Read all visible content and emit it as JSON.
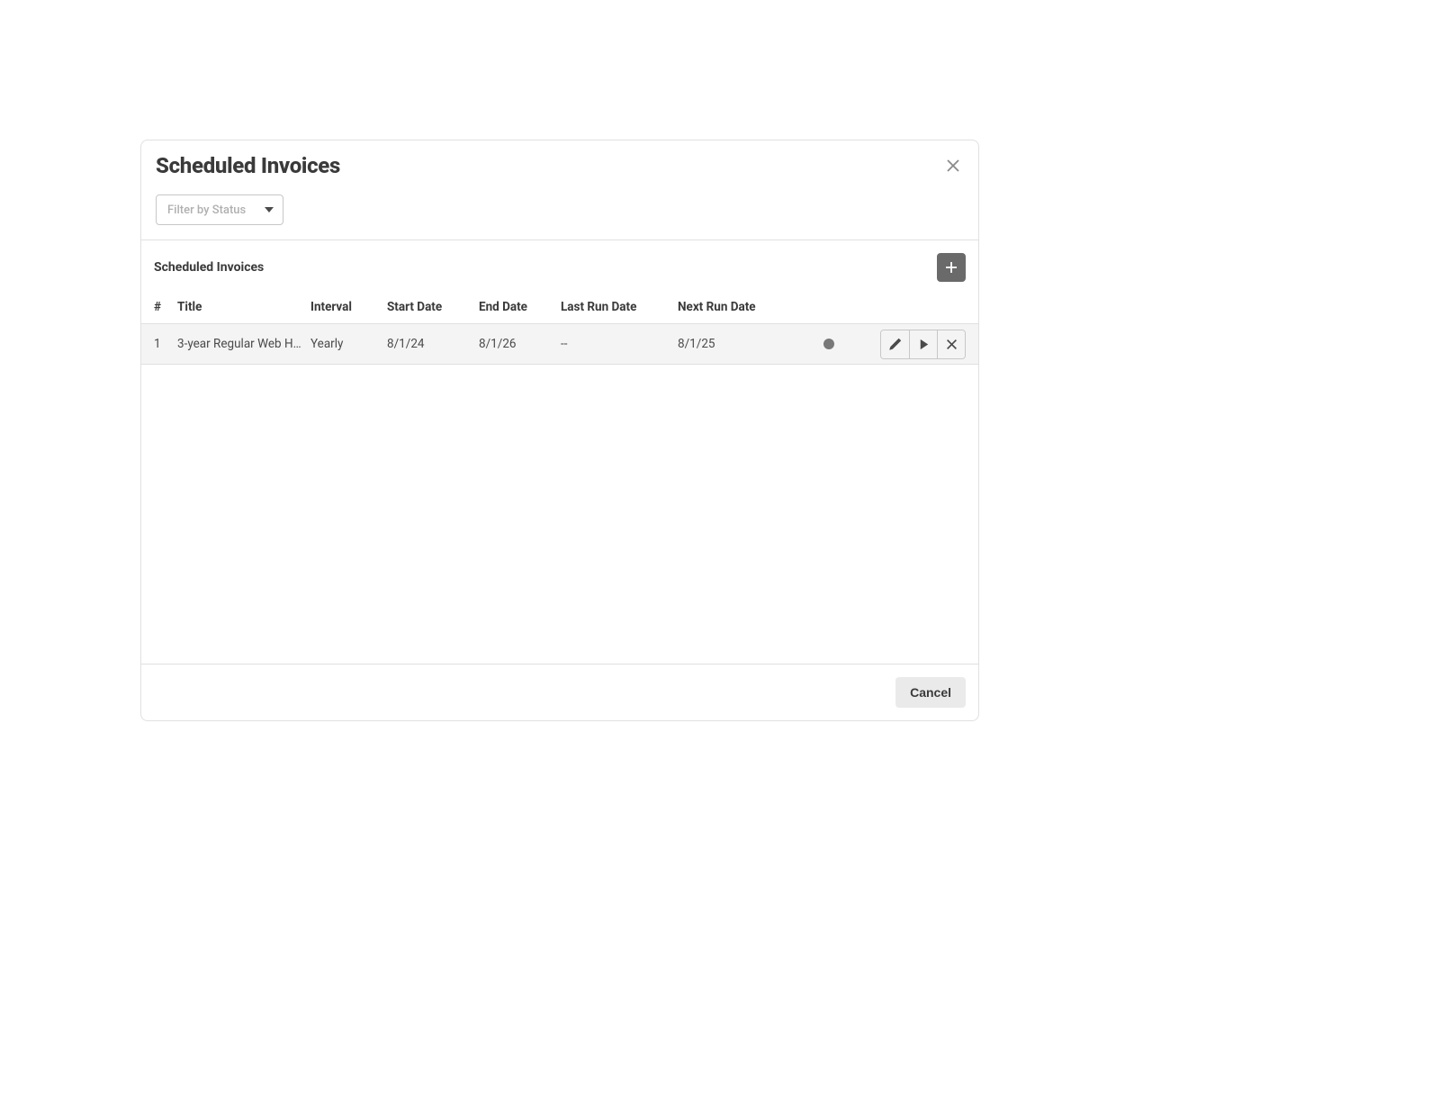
{
  "modal": {
    "title": "Scheduled Invoices",
    "filter_placeholder": "Filter by Status",
    "section_title": "Scheduled Invoices",
    "cancel_label": "Cancel"
  },
  "table": {
    "headers": {
      "num": "#",
      "title": "Title",
      "interval": "Interval",
      "start_date": "Start Date",
      "end_date": "End Date",
      "last_run": "Last Run Date",
      "next_run": "Next Run Date"
    },
    "rows": [
      {
        "num": "1",
        "title": "3-year Regular Web H…",
        "interval": "Yearly",
        "start_date": "8/1/24",
        "end_date": "8/1/26",
        "last_run": "--",
        "next_run": "8/1/25"
      }
    ]
  }
}
